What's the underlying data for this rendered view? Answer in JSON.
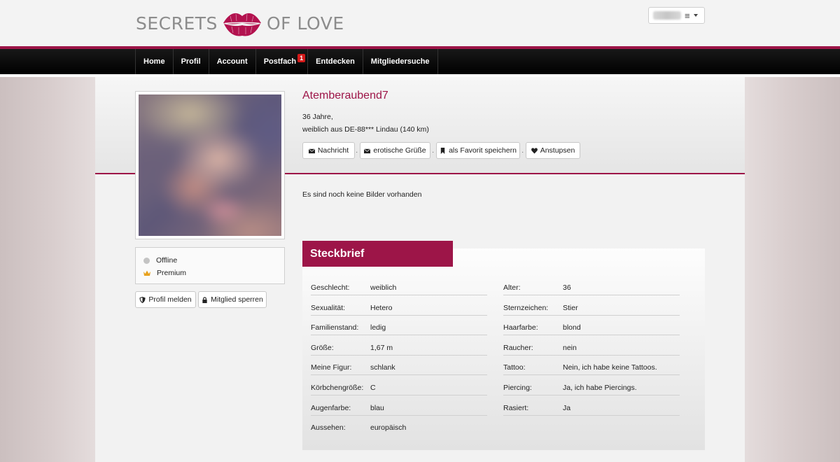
{
  "brand": {
    "left_text": "SECRETS",
    "right_text": "OF LOVE",
    "lips_color": "#b3124f"
  },
  "header": {
    "menu_icon": "≡"
  },
  "colors": {
    "accent": "#9d1548",
    "badge": "#d41a1a",
    "nav_bg": "#000000"
  },
  "nav": {
    "items": [
      {
        "label": "Home"
      },
      {
        "label": "Profil"
      },
      {
        "label": "Account"
      },
      {
        "label": "Postfach",
        "badge": "1"
      },
      {
        "label": "Entdecken"
      },
      {
        "label": "Mitgliedersuche"
      }
    ]
  },
  "profile": {
    "name": "Atemberaubend7",
    "age": "36 Jahre,",
    "location": "weiblich aus DE-88*** Lindau (140 km)",
    "actions": [
      {
        "label": "Nachricht",
        "icon": "envelope-icon"
      },
      {
        "label": "erotische Grüße",
        "icon": "envelope-icon"
      },
      {
        "label": "als Favorit speichern",
        "icon": "bookmark-icon"
      },
      {
        "label": "Anstupsen",
        "icon": "heart-icon"
      }
    ],
    "action_separator": "·",
    "no_pictures": "Es sind noch keine Bilder vorhanden"
  },
  "status": {
    "online": "Offline",
    "membership": "Premium"
  },
  "side_buttons": {
    "report": "Profil melden",
    "block": "Mitglied sperren"
  },
  "steckbrief": {
    "title": "Steckbrief",
    "left": [
      {
        "label": "Geschlecht:",
        "value": "weiblich"
      },
      {
        "label": "Sexualität:",
        "value": "Hetero"
      },
      {
        "label": "Familienstand:",
        "value": "ledig"
      },
      {
        "label": "Größe:",
        "value": "1,67 m"
      },
      {
        "label": "Meine Figur:",
        "value": "schlank"
      },
      {
        "label": "Körbchengröße:",
        "value": "C"
      },
      {
        "label": "Augenfarbe:",
        "value": "blau"
      },
      {
        "label": "Aussehen:",
        "value": "europäisch"
      }
    ],
    "right": [
      {
        "label": "Alter:",
        "value": "36"
      },
      {
        "label": "Sternzeichen:",
        "value": "Stier"
      },
      {
        "label": "Haarfarbe:",
        "value": "blond"
      },
      {
        "label": "Raucher:",
        "value": "nein"
      },
      {
        "label": "Tattoo:",
        "value": "Nein, ich habe keine Tattoos."
      },
      {
        "label": "Piercing:",
        "value": "Ja, ich habe Piercings."
      },
      {
        "label": "Rasiert:",
        "value": "Ja"
      }
    ]
  }
}
